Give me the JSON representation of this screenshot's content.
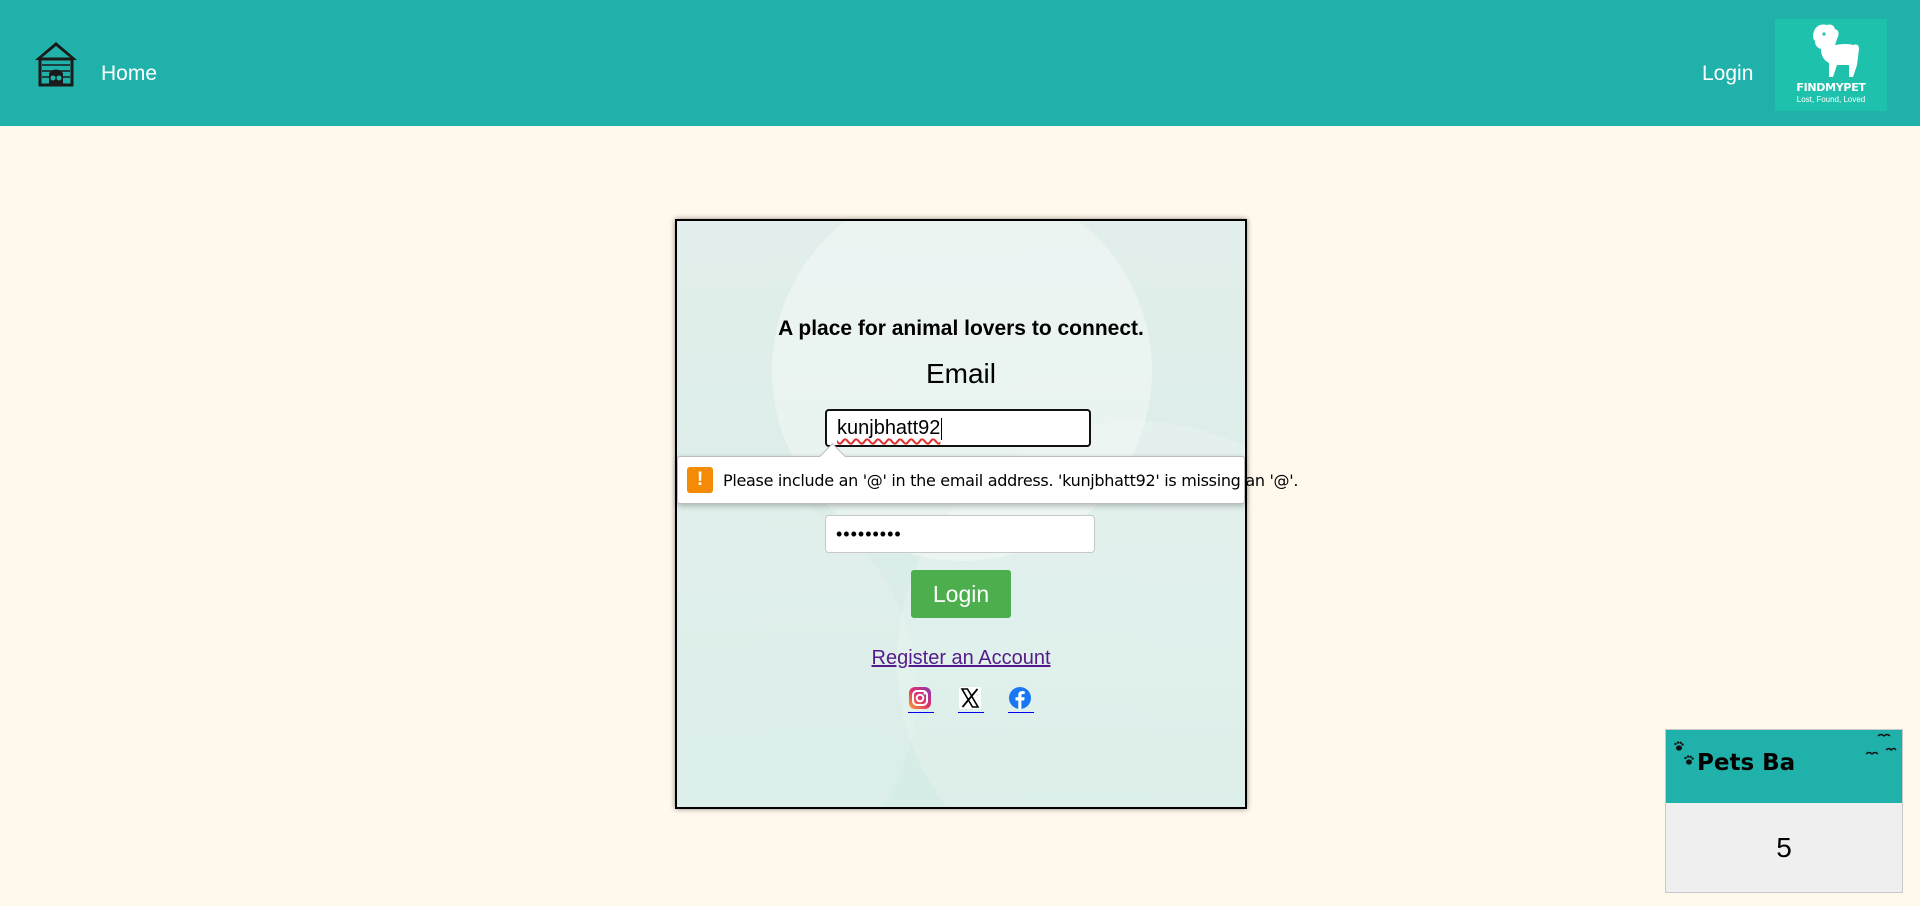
{
  "nav": {
    "home_label": "Home",
    "login_label": "Login",
    "brand_name": "FINDMYPET",
    "brand_tagline": "Lost, Found, Loved"
  },
  "login_card": {
    "tagline": "A place for animal lovers to connect.",
    "email_label": "Email",
    "email_value": "kunjbhatt92",
    "password_value": "•••••••••",
    "login_button": "Login",
    "register_link": "Register an Account",
    "social": [
      "instagram-icon",
      "x-icon",
      "facebook-icon"
    ]
  },
  "validation_tooltip": {
    "message": "Please include an '@' in the email address. 'kunjbhatt92' is missing an '@'."
  },
  "pets_widget": {
    "title": "Pets Ba",
    "count": "5"
  },
  "colors": {
    "nav_bg": "#20b2aa",
    "page_bg": "#fff8ec",
    "button_green": "#4cae4c",
    "warning_orange": "#f58a07",
    "link_purple": "#551a8b"
  }
}
